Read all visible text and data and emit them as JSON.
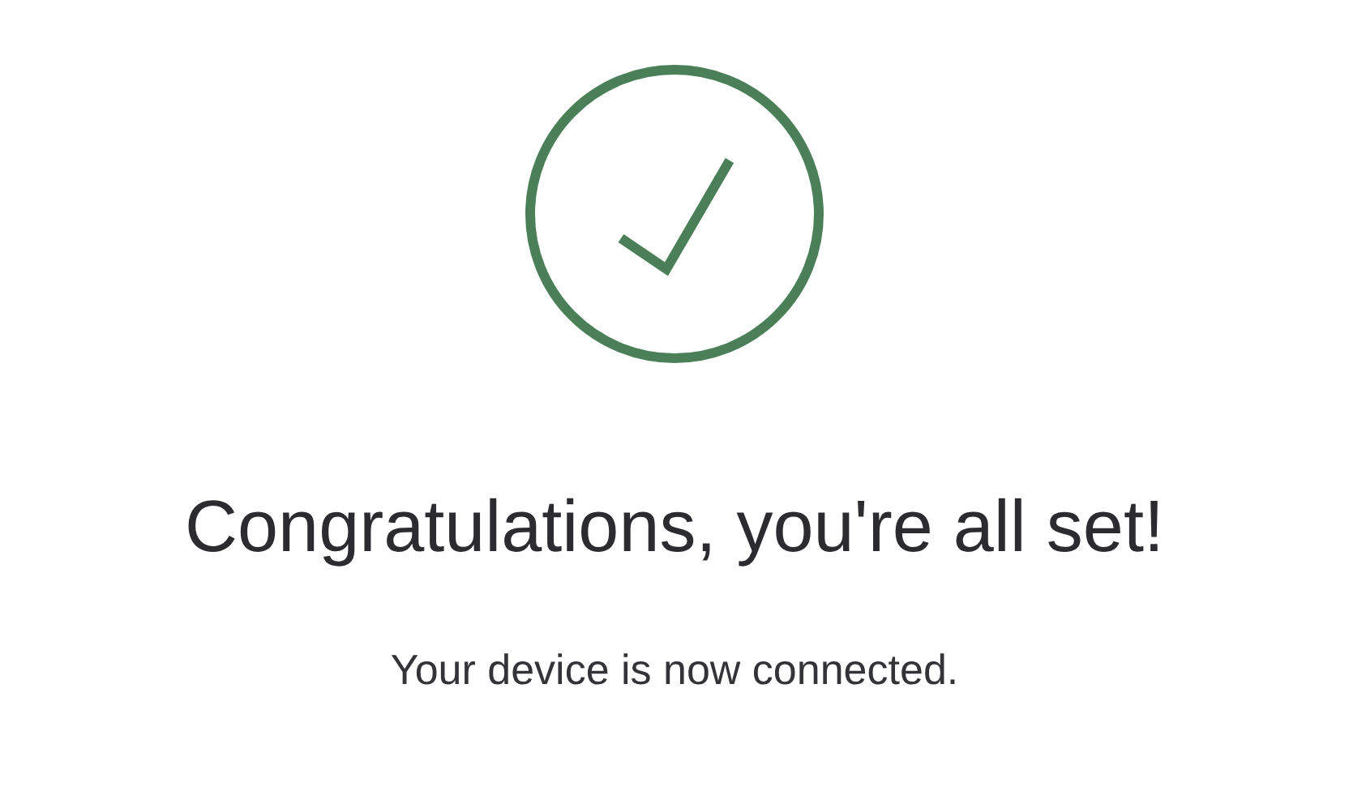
{
  "title": "Congratulations, you're all set!",
  "message": "Your device is now connected."
}
